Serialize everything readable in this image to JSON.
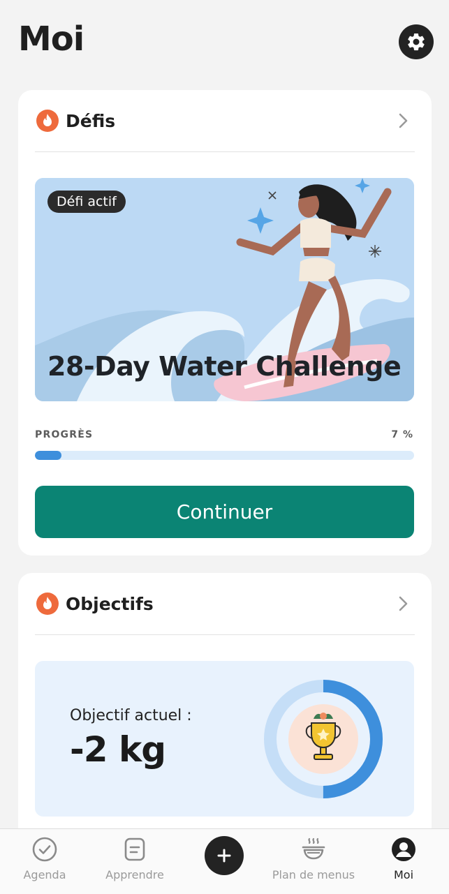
{
  "header": {
    "title": "Moi",
    "settings_icon": "gear-icon"
  },
  "challenges": {
    "title": "Défis",
    "icon": "flame-icon",
    "banner": {
      "badge": "Défi actif",
      "title": "28-Day Water Challenge"
    },
    "progress": {
      "label": "PROGRÈS",
      "value_text": "7 %",
      "value": 0.07
    },
    "continue_label": "Continuer"
  },
  "goals": {
    "title": "Objectifs",
    "icon": "flame-icon",
    "current_label": "Objectif actuel :",
    "current_value": "-2 kg",
    "ring_progress": 0.5
  },
  "tabbar": {
    "items": [
      {
        "label": "Agenda",
        "icon": "check-circle-icon",
        "active": false
      },
      {
        "label": "Apprendre",
        "icon": "note-icon",
        "active": false
      },
      {
        "label": "",
        "icon": "plus-icon",
        "active": false
      },
      {
        "label": "Plan de menus",
        "icon": "bowl-icon",
        "active": false
      },
      {
        "label": "Moi",
        "icon": "user-icon",
        "active": true
      }
    ]
  },
  "colors": {
    "accent_green": "#0b8474",
    "progress_blue": "#3e8fdc",
    "flame_orange": "#ee6a3c",
    "background": "#f3f3f3"
  }
}
